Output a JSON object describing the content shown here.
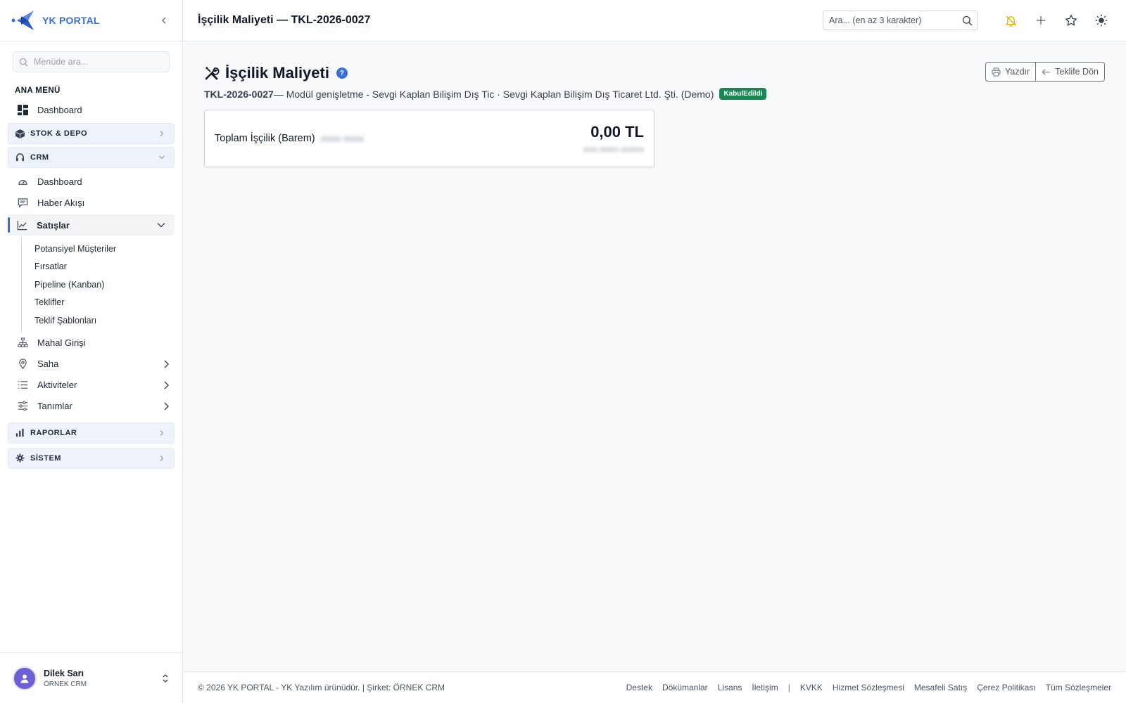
{
  "brand": {
    "name": "YK PORTAL"
  },
  "sidebar": {
    "search_placeholder": "Menüde ara...",
    "section_label": "ANA MENÜ",
    "dashboard": "Dashboard",
    "groups": {
      "stok": "STOK & DEPO",
      "crm": "CRM",
      "raporlar": "RAPORLAR",
      "sistem": "SİSTEM"
    },
    "crm_items": {
      "dashboard": "Dashboard",
      "haber": "Haber Akışı",
      "satislar": "Satışlar",
      "mahal": "Mahal Girişi",
      "saha": "Saha",
      "aktiviteler": "Aktiviteler",
      "tanimlar": "Tanımlar"
    },
    "satislar_sub": [
      "Potansiyel Müşteriler",
      "Fırsatlar",
      "Pipeline (Kanban)",
      "Teklifler",
      "Teklif Şablonları"
    ]
  },
  "user": {
    "name": "Dilek Sarı",
    "company": "ÖRNEK CRM"
  },
  "header": {
    "title": "İşçilik Maliyeti — TKL-2026-0027",
    "search_placeholder": "Ara... (en az 3 karakter)"
  },
  "page": {
    "title": "İşçilik Maliyeti",
    "help": "?",
    "print_label": "Yazdır",
    "back_label": "Teklife Dön",
    "code": "TKL-2026-0027",
    "description": " — Modül genişletme - Sevgi Kaplan Bilişim Dış Tic · Sevgi Kaplan Bilişim Dış Ticaret Ltd. Şti. (Demo)",
    "status": "KabulEdildi"
  },
  "cost": {
    "label": "Toplam İşçilik (Barem)",
    "value": "0,00 TL"
  },
  "footer": {
    "copyright": "© 2026 YK PORTAL - YK Yazılım ürünüdür. | Şirket: ÖRNEK CRM",
    "links": [
      "Destek",
      "Dökümanlar",
      "Lisans",
      "İletişim"
    ],
    "separator": "|",
    "legal": [
      "KVKK",
      "Hizmet Sözleşmesi",
      "Mesafeli Satış",
      "Çerez Politikası",
      "Tüm Sözleşmeler"
    ]
  },
  "colors": {
    "accent": "#3b6fd8",
    "success": "#198754",
    "bell": "#e0b400"
  }
}
